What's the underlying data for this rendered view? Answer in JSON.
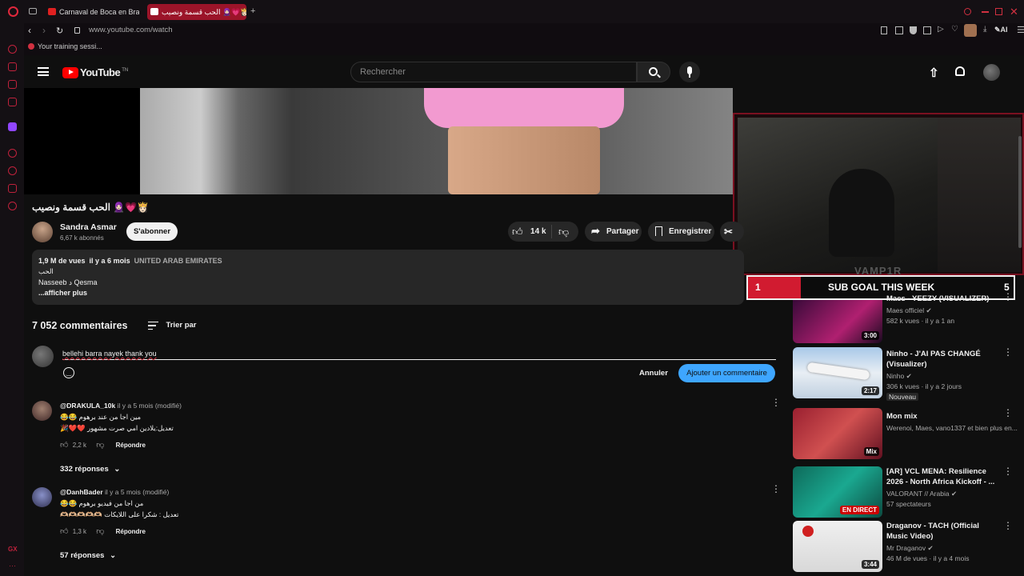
{
  "browser": {
    "tabs": [
      {
        "label": "Carnaval de Boca en Bras",
        "active": false
      },
      {
        "label": "الحب قسمة ونصيب 🧕🏻💗👸🏻",
        "active": true
      }
    ],
    "url": "www.youtube.com/watch",
    "bookmark": "Your training sessi...",
    "ai_label": "AI"
  },
  "header": {
    "logo_text": "YouTube",
    "logo_sup": "TN",
    "search_placeholder": "Rechercher"
  },
  "video": {
    "title": "الحب قسمة ونصيب 🧕🏻💗👸🏻",
    "channel": "Sandra Asmar",
    "subscribers": "6,67 k abonnés",
    "subscribe_label": "S'abonner",
    "likes": "14 k",
    "share_label": "Partager",
    "save_label": "Enregistrer"
  },
  "description": {
    "views": "1,9 M de vues",
    "age": "il y a 6 mois",
    "country": "UNITED ARAB EMIRATES",
    "line1": "الحب",
    "line2": "Nasseeb د Qesma",
    "more": "...afficher plus"
  },
  "comments": {
    "count": "7 052 commentaires",
    "sort_label": "Trier par",
    "draft": "bellehi barra nayek thank you",
    "cancel_label": "Annuler",
    "submit_label": "Ajouter un commentaire",
    "items": [
      {
        "author": "@DRAKULA_10k",
        "meta": "il y a 5 mois (modifié)",
        "line1": "مين اجا من عند برهوم 😂😂",
        "line2": "تعديل:يلادين امي صرت مشهور ❤️❤️🎉",
        "likes": "2,2 k",
        "reply": "Répondre",
        "replies": "332 réponses"
      },
      {
        "author": "@DanhBader",
        "meta": "il y a 5 mois (modifié)",
        "line1": "من اجا من فيديو برهوم 😂😂",
        "line2": "تعديل : شكرا على اللايكات 🫶🏼🫶🏼🫶🏼🫶🏼🫶🏼",
        "likes": "1,3 k",
        "reply": "Répondre",
        "replies": "57 réponses"
      }
    ]
  },
  "overlay": {
    "streamer_name": "VAMP1R",
    "sub_goal_label": "SUB GOAL THIS WEEK",
    "sub_goal_current": "1",
    "sub_goal_target": "5",
    "progress": 0.2
  },
  "recommendations": [
    {
      "title": "Maes - YEEZY (VISUALIZER)",
      "channel": "Maes officiel",
      "meta": "582 k vues · il y a 1 an",
      "duration": "3:00",
      "badge": ""
    },
    {
      "title": "Ninho - J'AI PAS CHANGÉ (Visualizer)",
      "channel": "Ninho",
      "meta": "306 k vues · il y a 2 jours",
      "duration": "2:17",
      "badge": "Nouveau"
    },
    {
      "title": "Mon mix",
      "channel": "Werenoi, Maes, vano1337 et bien plus en...",
      "meta": "",
      "duration": "Mix",
      "badge": ""
    },
    {
      "title": "[AR] VCL MENA: Resilience 2026 - North Africa Kickoff - ...",
      "channel": "VALORANT // Arabia",
      "meta": "57 spectateurs",
      "duration": "EN DIRECT",
      "badge": ""
    },
    {
      "title": "Draganov - TACH (Official Music Video)",
      "channel": "Mr Draganov",
      "meta": "46 M de vues · il y a 4 mois",
      "duration": "3:44",
      "badge": ""
    }
  ],
  "colors": {
    "accent": "#e8174f",
    "yt_red": "#ff0000",
    "blue_button": "#3ea6ff"
  }
}
